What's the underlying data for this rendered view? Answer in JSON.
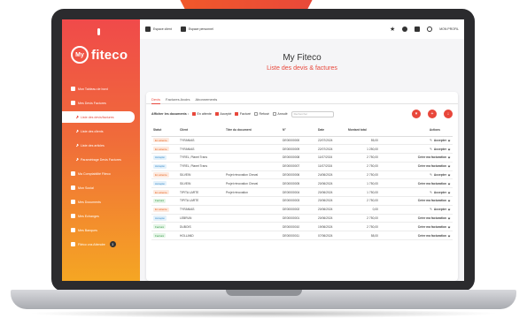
{
  "app": {
    "logo_prefix": "My",
    "logo_text": "fiteco"
  },
  "sidebar": {
    "items": [
      {
        "label": "Mon Tableau de bord",
        "type": "main"
      },
      {
        "label": "Mes Devis Factures",
        "type": "main"
      },
      {
        "label": "Liste des devis/factures",
        "type": "sub",
        "active": true
      },
      {
        "label": "Liste des clients",
        "type": "sub"
      },
      {
        "label": "Liste des articles",
        "type": "sub"
      },
      {
        "label": "Paramétrage Devis Factures",
        "type": "sub"
      },
      {
        "label": "Ma Comptabilité Fiteco",
        "type": "main"
      },
      {
        "label": "Mon Social",
        "type": "main"
      },
      {
        "label": "Mes Documents",
        "type": "main"
      },
      {
        "label": "Mes Echanges",
        "type": "main"
      },
      {
        "label": "Mes Banques",
        "type": "main"
      },
      {
        "label": "Fitéco vos Attendre",
        "type": "main",
        "badge": "3"
      }
    ]
  },
  "topbar": {
    "btn1": "Espace client",
    "btn2": "Espace personnel",
    "user": "MON PROFIL"
  },
  "hero": {
    "title": "My Fiteco",
    "subtitle": "Liste des devis & factures"
  },
  "tabs": [
    "Devis",
    "Factures Avoirs",
    "Abonnements"
  ],
  "filters": {
    "label": "Afficher les documents :",
    "options": [
      {
        "label": "En attente",
        "checked": true
      },
      {
        "label": "Accepté",
        "checked": true
      },
      {
        "label": "Facturé",
        "checked": true
      },
      {
        "label": "Refusé",
        "checked": false
      },
      {
        "label": "Annulé",
        "checked": false
      }
    ],
    "search_placeholder": "Rechercher"
  },
  "table": {
    "columns": [
      "Statut",
      "Client",
      "Titre du document",
      "N°",
      "Date",
      "Montant total",
      "Actions"
    ],
    "rows": [
      {
        "status": "En attente",
        "status_kind": "att",
        "client": "TYRANIAS",
        "title": "",
        "num": "DE00000000",
        "date": "22/07/2024",
        "amount": "55,00",
        "action": "Accepter"
      },
      {
        "status": "En attente",
        "status_kind": "att",
        "client": "TYRANIAS",
        "title": "",
        "num": "DE00000009",
        "date": "22/07/2024",
        "amount": "1 250,00",
        "action": "Accepter"
      },
      {
        "status": "Accepté",
        "status_kind": "acc",
        "client": "TYREL, Planet Trans",
        "title": "",
        "num": "DE00000008",
        "date": "11/07/2024",
        "amount": "2 750,00",
        "action": "Créer ma facturation"
      },
      {
        "status": "Accepté",
        "status_kind": "acc",
        "client": "TYREL, Planet Trans",
        "title": "",
        "num": "DE00000007",
        "date": "11/07/2024",
        "amount": "2 750,00",
        "action": "Créer ma facturation"
      },
      {
        "status": "En attente",
        "status_kind": "att",
        "client": "SILVEIN",
        "title": "Projet rénovation Cheval",
        "num": "DE00000006",
        "date": "24/06/2024",
        "amount": "2 750,00",
        "action": "Accepter"
      },
      {
        "status": "Accepté",
        "status_kind": "acc",
        "client": "SILVEIN",
        "title": "Projet rénovation Cheval",
        "num": "DE00000005",
        "date": "20/06/2024",
        "amount": "1 750,00",
        "action": "Créer ma facturation"
      },
      {
        "status": "En attente",
        "status_kind": "att",
        "client": "TIPITA LARTE",
        "title": "Projet rénovation",
        "num": "DE00000004",
        "date": "20/06/2024",
        "amount": "1 750,00",
        "action": "Accepter"
      },
      {
        "status": "Facturé",
        "status_kind": "fac",
        "client": "TIPITA LARTE",
        "title": "",
        "num": "DE00000003",
        "date": "20/06/2024",
        "amount": "2 750,00",
        "action": "Créer ma facturation"
      },
      {
        "status": "En attente",
        "status_kind": "att",
        "client": "TYRANIAS",
        "title": "",
        "num": "DE00000002",
        "date": "20/06/2024",
        "amount": "0,00",
        "action": "Accepter"
      },
      {
        "status": "Accepté",
        "status_kind": "acc",
        "client": "LEBRUN",
        "title": "",
        "num": "DE00000001",
        "date": "20/06/2024",
        "amount": "2 750,00",
        "action": "Créer ma facturation"
      },
      {
        "status": "Facturé",
        "status_kind": "fac",
        "client": "DUBOIS",
        "title": "",
        "num": "DE00000010",
        "date": "19/06/2024",
        "amount": "2 750,00",
        "action": "Créer ma facturation"
      },
      {
        "status": "Facturé",
        "status_kind": "fac",
        "client": "HOLLAND",
        "title": "",
        "num": "DE00000011",
        "date": "07/06/2024",
        "amount": "58,00",
        "action": "Créer ma facturation"
      }
    ]
  }
}
